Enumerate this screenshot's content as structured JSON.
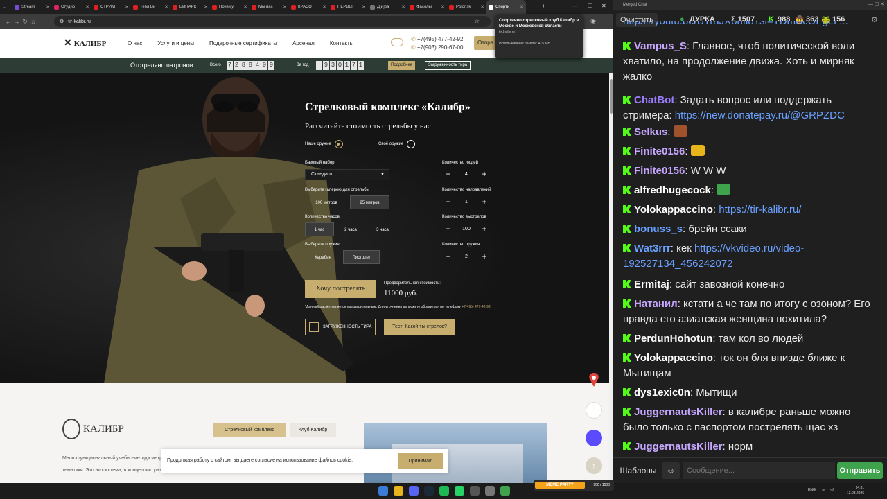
{
  "browser": {
    "tabs": [
      {
        "label": "Stream",
        "color": "#7b4bd6"
      },
      {
        "label": "Студио",
        "color": "#e0245e"
      },
      {
        "label": "СТРИМ",
        "color": "#e02020"
      },
      {
        "label": "Тебя Ви",
        "color": "#e02020"
      },
      {
        "label": "БИНАРК",
        "color": "#e02020"
      },
      {
        "label": "Почему",
        "color": "#e02020"
      },
      {
        "label": "Мы нас",
        "color": "#e02020"
      },
      {
        "label": "КРАСОТ",
        "color": "#e02020"
      },
      {
        "label": "ПЕРВЫ",
        "color": "#e02020"
      },
      {
        "label": "Д[и]ра",
        "color": "#777"
      },
      {
        "label": "Фасолы",
        "color": "#e02020"
      },
      {
        "label": "Polonsk",
        "color": "#e02020"
      },
      {
        "label": "Спорти",
        "color": "#fff",
        "active": true
      }
    ],
    "url": "tir-kalibr.ru",
    "tooltip": {
      "title": "Спортивно стрелковый клуб Калибр в Москве и Московской области",
      "domain": "tir-kalibr.ru",
      "memory": "Использование памяти: 415 МБ"
    }
  },
  "site": {
    "logo": "КАЛИБР",
    "menu": [
      "О нас",
      "Услуги и цены",
      "Подарочные сертификаты",
      "Арсенал",
      "Контакты"
    ],
    "phones": [
      "+7(495) 477-42-92",
      "+7(903) 290-67-00"
    ],
    "send_label": "Отпра",
    "counter": {
      "title": "Отстреляно патронов",
      "all_label": "Всего",
      "all_digits": [
        "7",
        "2",
        "8",
        "8",
        "4",
        "9",
        "9"
      ],
      "year_label": "За год",
      "year_digits": [
        "",
        "9",
        "3",
        "0",
        "1",
        "7",
        "1"
      ],
      "btn_gift": "Подробнее",
      "btn_load": "Загруженность тира"
    },
    "hero": {
      "title": "Стрелковый комплекс «Калибр»",
      "subtitle": "Рассчитайте стоимость стрельбы у нас",
      "radio_our": "Наше оружие",
      "radio_own": "Своё оружие",
      "base_label": "Базовый набор",
      "base_value": "Стандарт",
      "gallery_label": "Выберите галерею для стрельбы",
      "gallery_opts": [
        "100 метров",
        "25 метров"
      ],
      "hours_label": "Количество часов",
      "hours_opts": [
        "1 час",
        "2 часа",
        "3 часа"
      ],
      "weapon_label": "Выберите оружие",
      "weapon_opts": [
        "Карабин",
        "Пистолет"
      ],
      "people_label": "Количество людей",
      "people_value": "4",
      "lanes_label": "Количество направлений",
      "lanes_value": "1",
      "shots_label": "Количество выстрелов",
      "shots_value": "100",
      "guns_label": "Количество оружия",
      "guns_value": "2",
      "cta": "Хочу пострелять",
      "price_label": "Предварительная стоимость:",
      "price_value": "11000 руб.",
      "note": "*Данный расчёт является предварительным. Для уточнения вы можете обратиться по телефону",
      "note_phone": "+7(495) 477-42-92",
      "load_btn": "ЗАГРУЖЕННОСТЬ ТИРА",
      "test_btn": "Тест: Какой ты стрелок?"
    },
    "lower": {
      "logo": "КАЛИБР",
      "tag_active": "Стрелковый комплекс",
      "tag_other": "Клуб Калибр",
      "text": "Многофункциональный учебно-методи метров, являет собой современный ор услуг оружейной и околооружейной тематики. Это экосистема, в концепцию развития которой входят все"
    },
    "cookie": {
      "text": "Продолжая работу с сайтом, вы даете согласие на использование файлов cookie.",
      "accept": "Принимаю"
    }
  },
  "taskbar": {
    "lang": "ENG",
    "time": "14:31",
    "date": "13.08.2026",
    "meme_label": "MEME PARTY",
    "meme_count": "900 / 1500"
  },
  "chat": {
    "window_title": "Merged Chat",
    "clear": "Очистить",
    "stats": {
      "status": "ДУРКА",
      "total": "Σ 1507",
      "kick": "988",
      "other1": "363",
      "other2": "156"
    },
    "messages": [
      {
        "top_text": "https://youtu.be/BTraJXonfl8?si=TDmBcOFgLP..."
      },
      {
        "nick": "Vampus_S",
        "color": "#c6a6ff",
        "text": "Главное, чтоб политической воли хватило, на продолжение движа. Хоть и мирняк жалко"
      },
      {
        "nick": "ChatBot",
        "color": "#9a7cff",
        "text": "Задать вопрос или поддержать стримера:",
        "link": "https://new.donatepay.ru/@GRPZDC"
      },
      {
        "nick": "Selkus",
        "color": "#c6a6ff",
        "text": ""
      },
      {
        "nick": "Finite0156",
        "color": "#c6a6ff",
        "text": ""
      },
      {
        "nick": "Finite0156",
        "color": "#c6a6ff",
        "text": "W W W"
      },
      {
        "nick": "alfredhugecock",
        "color": "#ffffff",
        "text": ""
      },
      {
        "nick": "Yolokappaccino",
        "color": "#ffffff",
        "text": "",
        "link": "https://tir-kalibr.ru/"
      },
      {
        "nick": "bonuss_s",
        "color": "#6aa0ff",
        "text": "брейн ссаки"
      },
      {
        "nick": "Wat3rrr",
        "color": "#6aa0ff",
        "text": "кек",
        "link": "https://vkvideo.ru/video-192527134_456242072"
      },
      {
        "nick": "Ermitaj",
        "color": "#ffffff",
        "text": "сайт завозной конечно"
      },
      {
        "nick": "Натанил",
        "color": "#c6a6ff",
        "text": "кстати а че там по итогу с озоном? Его правда его азиатская женщина похитила?"
      },
      {
        "nick": "PerdunHohotun",
        "color": "#ffffff",
        "text": "там кол во людей"
      },
      {
        "nick": "Yolokappaccino",
        "color": "#ffffff",
        "text": "ток он бля впизде ближе к Мытищам"
      },
      {
        "nick": "dys1exic0n",
        "color": "#ffffff",
        "text": "Мытищи"
      },
      {
        "nick": "JuggernautsKiller",
        "color": "#c6a6ff",
        "text": "в калибре раньше можно было только с паспортом пострелять щас хз"
      },
      {
        "nick": "JuggernautsKiller",
        "color": "#c6a6ff",
        "text": "норм"
      }
    ],
    "templates": "Шаблоны",
    "input_placeholder": "Сообщение...",
    "send": "Отправить"
  }
}
